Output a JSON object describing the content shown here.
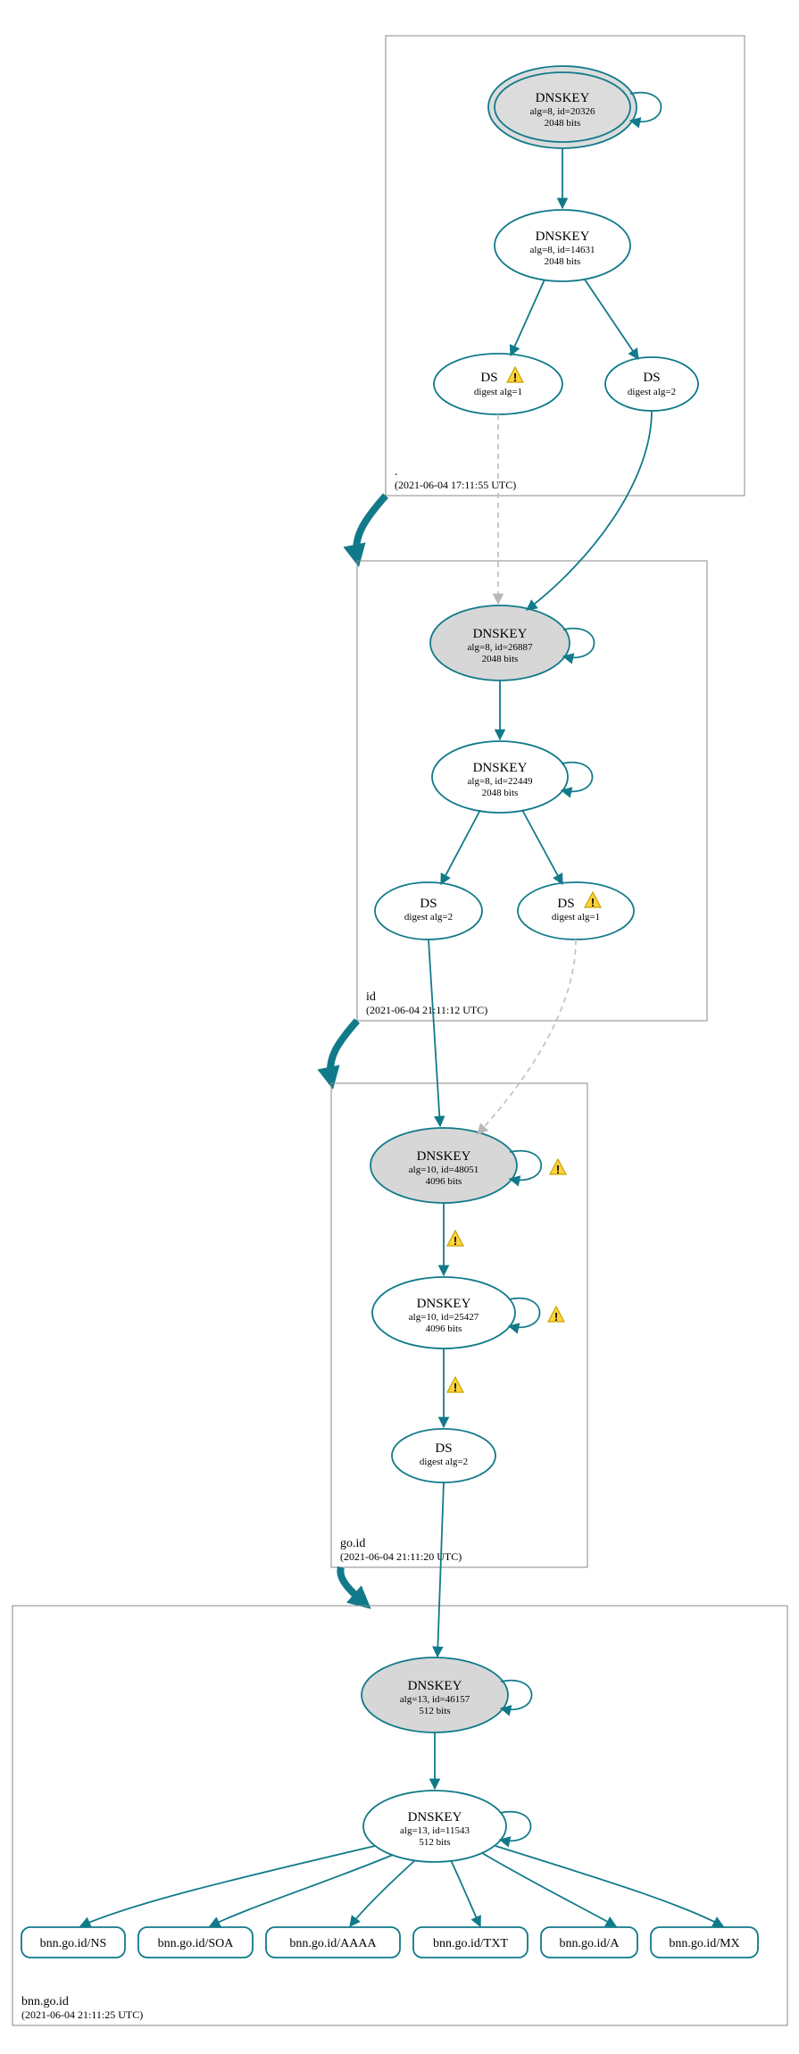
{
  "colors": {
    "stroke": "#117a8a",
    "fill_grey": "#d7d7d7"
  },
  "zones": {
    "root": {
      "label": ".",
      "timestamp": "(2021-06-04 17:11:55 UTC)",
      "ksk": {
        "title": "DNSKEY",
        "line1": "alg=8, id=20326",
        "line2": "2048 bits"
      },
      "zsk": {
        "title": "DNSKEY",
        "line1": "alg=8, id=14631",
        "line2": "2048 bits"
      },
      "ds1": {
        "title": "DS",
        "sub": "digest alg=1"
      },
      "ds2": {
        "title": "DS",
        "sub": "digest alg=2"
      }
    },
    "id": {
      "label": "id",
      "timestamp": "(2021-06-04 21:11:12 UTC)",
      "ksk": {
        "title": "DNSKEY",
        "line1": "alg=8, id=26887",
        "line2": "2048 bits"
      },
      "zsk": {
        "title": "DNSKEY",
        "line1": "alg=8, id=22449",
        "line2": "2048 bits"
      },
      "ds1": {
        "title": "DS",
        "sub": "digest alg=2"
      },
      "ds2": {
        "title": "DS",
        "sub": "digest alg=1"
      }
    },
    "goid": {
      "label": "go.id",
      "timestamp": "(2021-06-04 21:11:20 UTC)",
      "ksk": {
        "title": "DNSKEY",
        "line1": "alg=10, id=48051",
        "line2": "4096 bits"
      },
      "zsk": {
        "title": "DNSKEY",
        "line1": "alg=10, id=25427",
        "line2": "4096 bits"
      },
      "ds": {
        "title": "DS",
        "sub": "digest alg=2"
      }
    },
    "bnn": {
      "label": "bnn.go.id",
      "timestamp": "(2021-06-04 21:11:25 UTC)",
      "ksk": {
        "title": "DNSKEY",
        "line1": "alg=13, id=46157",
        "line2": "512 bits"
      },
      "zsk": {
        "title": "DNSKEY",
        "line1": "alg=13, id=11543",
        "line2": "512 bits"
      },
      "rrsets": {
        "ns": "bnn.go.id/NS",
        "soa": "bnn.go.id/SOA",
        "aaaa": "bnn.go.id/AAAA",
        "txt": "bnn.go.id/TXT",
        "a": "bnn.go.id/A",
        "mx": "bnn.go.id/MX"
      }
    }
  }
}
